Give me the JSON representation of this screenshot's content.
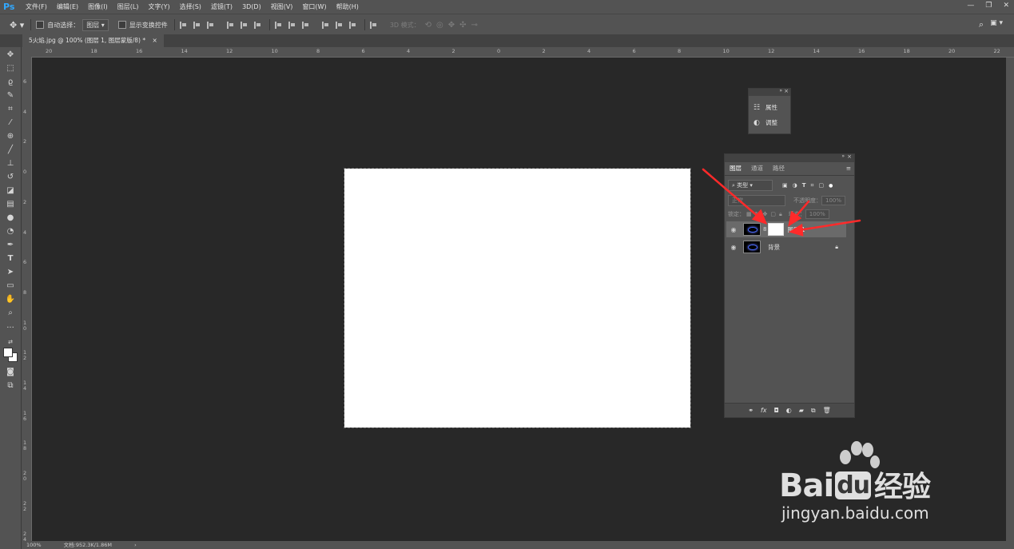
{
  "app": {
    "logo": "Ps"
  },
  "menu": [
    "文件(F)",
    "编辑(E)",
    "图像(I)",
    "图层(L)",
    "文字(Y)",
    "选择(S)",
    "滤镜(T)",
    "3D(D)",
    "视图(V)",
    "窗口(W)",
    "帮助(H)"
  ],
  "options": {
    "auto_select_label": "自动选择：",
    "auto_select_value": "图层",
    "show_transform_label": "显示变换控件",
    "mode_3d_label": "3D 模式："
  },
  "document": {
    "tab_title": "5火焰.jpg @ 100% (图层 1, 图层蒙版/8) *",
    "tab_close": "×"
  },
  "ruler_top": [
    "20",
    "18",
    "16",
    "14",
    "12",
    "10",
    "8",
    "6",
    "4",
    "2",
    "0",
    "2",
    "4",
    "6",
    "8",
    "10",
    "12",
    "14",
    "16",
    "18",
    "20",
    "22",
    "24"
  ],
  "ruler_left": [
    "6",
    "4",
    "2",
    "0",
    "2",
    "4",
    "6",
    "8",
    "1 0",
    "1 2",
    "1 4",
    "1 6",
    "1 8",
    "2 0",
    "2 2",
    "2 4"
  ],
  "status": {
    "zoom": "100%",
    "doc_info": "文档:952.3K/1.86M",
    "arrow": "›"
  },
  "mini_panel": {
    "items": [
      {
        "label": "属性",
        "icon": "properties-icon"
      },
      {
        "label": "调整",
        "icon": "adjustments-icon"
      }
    ]
  },
  "layers_panel": {
    "tabs": [
      "图层",
      "通道",
      "路径"
    ],
    "filter_label": "类型",
    "blend_mode": "正常",
    "opacity_label": "不透明度：",
    "opacity_value": "100%",
    "lock_label": "锁定：",
    "fill_label": "填充：",
    "fill_value": "100%",
    "layers": [
      {
        "name": "图层 1",
        "selected": true,
        "has_mask": true
      },
      {
        "name": "背景",
        "selected": false,
        "has_mask": false,
        "locked": true
      }
    ],
    "bottom_icons": [
      "link-icon",
      "fx-icon",
      "mask-icon",
      "adjustment-layer-icon",
      "folder-icon",
      "new-layer-icon",
      "trash-icon"
    ],
    "fx_label": "fx"
  },
  "watermark": {
    "brand": "Bai",
    "brand2": "du",
    "suffix": "经验",
    "url": "jingyan.baidu.com"
  },
  "colors": {
    "accent": "#31a8ff",
    "arrow": "#ff2a2a",
    "workspace": "#282828",
    "panel": "#535353"
  }
}
